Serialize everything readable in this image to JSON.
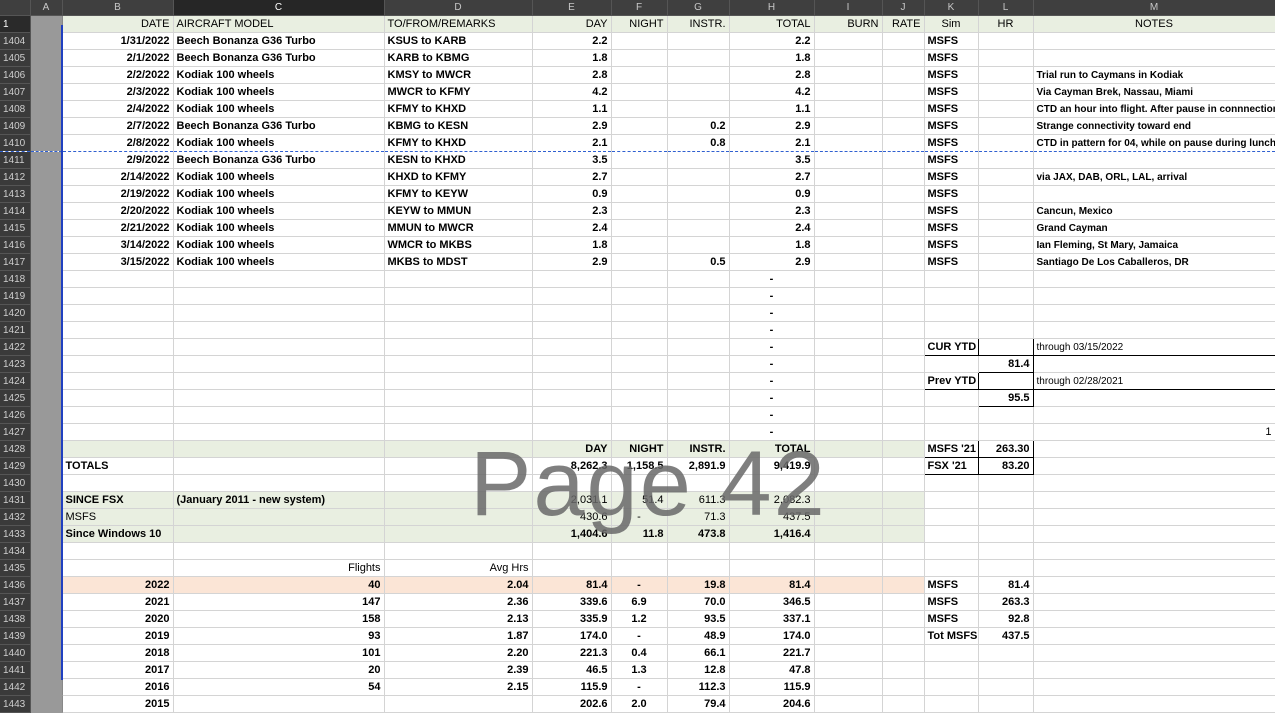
{
  "col_headers": [
    "",
    "A",
    "B",
    "C",
    "D",
    "E",
    "F",
    "G",
    "H",
    "I",
    "J",
    "K",
    "L",
    "M"
  ],
  "row_numbers": [
    "1",
    "1404",
    "1405",
    "1406",
    "1407",
    "1408",
    "1409",
    "1410",
    "1411",
    "1412",
    "1413",
    "1414",
    "1415",
    "1416",
    "1417",
    "1418",
    "1419",
    "1420",
    "1421",
    "1422",
    "1423",
    "1424",
    "1425",
    "1426",
    "1427",
    "1428",
    "1429",
    "1430",
    "1431",
    "1432",
    "1433",
    "1434",
    "1435",
    "1436",
    "1437",
    "1438",
    "1439",
    "1440",
    "1441",
    "1442",
    "1443"
  ],
  "headers": {
    "date": "DATE",
    "model": "AIRCRAFT MODEL",
    "route": "TO/FROM/REMARKS",
    "day": "DAY",
    "night": "NIGHT",
    "instr": "INSTR.",
    "total": "TOTAL",
    "burn": "BURN",
    "rate": "RATE",
    "sim": "Sim",
    "hr": "HR",
    "notes": "NOTES"
  },
  "flights": [
    {
      "date": "1/31/2022",
      "model": "Beech Bonanza G36 Turbo",
      "route": "KSUS to KARB",
      "day": "2.2",
      "instr": "",
      "total": "2.2",
      "sim": "MSFS",
      "note": "",
      "note_red": false
    },
    {
      "date": "2/1/2022",
      "model": "Beech Bonanza G36 Turbo",
      "route": "KARB to KBMG",
      "day": "1.8",
      "instr": "",
      "total": "1.8",
      "sim": "MSFS",
      "note": "",
      "note_red": false
    },
    {
      "date": "2/2/2022",
      "model": "Kodiak 100 wheels",
      "route": "KMSY to MWCR",
      "day": "2.8",
      "instr": "",
      "total": "2.8",
      "sim": "MSFS",
      "note": "Trial run to Caymans in Kodiak",
      "note_red": false
    },
    {
      "date": "2/3/2022",
      "model": "Kodiak 100 wheels",
      "route": "MWCR to KFMY",
      "day": "4.2",
      "instr": "",
      "total": "4.2",
      "sim": "MSFS",
      "note": "Via Cayman Brek, Nassau, Miami",
      "note_red": false
    },
    {
      "date": "2/4/2022",
      "model": "Kodiak 100 wheels",
      "route": "KFMY to KHXD",
      "day": "1.1",
      "instr": "",
      "total": "1.1",
      "sim": "MSFS",
      "note": "CTD an hour into flight. After pause in connnection",
      "note_red": true
    },
    {
      "date": "2/7/2022",
      "model": "Beech Bonanza G36 Turbo",
      "route": "KBMG to KESN",
      "day": "2.9",
      "instr": "0.2",
      "total": "2.9",
      "sim": "MSFS",
      "note": "Strange connectivity toward end",
      "note_red": false
    },
    {
      "date": "2/8/2022",
      "model": "Kodiak 100 wheels",
      "route": "KFMY to KHXD",
      "day": "2.1",
      "instr": "0.8",
      "total": "2.1",
      "sim": "MSFS",
      "note": "CTD in pattern for 04, while on pause during lunch",
      "note_red": true
    },
    {
      "date": "2/9/2022",
      "model": "Beech Bonanza G36 Turbo",
      "route": "KESN to KHXD",
      "day": "3.5",
      "instr": "",
      "total": "3.5",
      "sim": "MSFS",
      "note": "",
      "note_red": false
    },
    {
      "date": "2/14/2022",
      "model": "Kodiak 100 wheels",
      "route": "KHXD to KFMY",
      "day": "2.7",
      "instr": "",
      "total": "2.7",
      "sim": "MSFS",
      "note": "via JAX, DAB, ORL, LAL, arrival",
      "note_red": false
    },
    {
      "date": "2/19/2022",
      "model": "Kodiak 100 wheels",
      "route": "KFMY to KEYW",
      "day": "0.9",
      "instr": "",
      "total": "0.9",
      "sim": "MSFS",
      "note": "",
      "note_red": false
    },
    {
      "date": "2/20/2022",
      "model": "Kodiak 100 wheels",
      "route": "KEYW to MMUN",
      "day": "2.3",
      "instr": "",
      "total": "2.3",
      "sim": "MSFS",
      "note": "Cancun, Mexico",
      "note_red": false
    },
    {
      "date": "2/21/2022",
      "model": "Kodiak 100 wheels",
      "route": "MMUN to MWCR",
      "day": "2.4",
      "instr": "",
      "total": "2.4",
      "sim": "MSFS",
      "note": "Grand Cayman",
      "note_red": false
    },
    {
      "date": "3/14/2022",
      "model": "Kodiak 100 wheels",
      "route": "WMCR to MKBS",
      "day": "1.8",
      "instr": "",
      "total": "1.8",
      "sim": "MSFS",
      "note": "Ian Fleming, St Mary, Jamaica",
      "note_red": false
    },
    {
      "date": "3/15/2022",
      "model": "Kodiak 100 wheels",
      "route": "MKBS to MDST",
      "day": "2.9",
      "instr": "0.5",
      "total": "2.9",
      "sim": "MSFS",
      "note": "Santiago De Los Caballeros, DR",
      "note_red": false
    }
  ],
  "dash": "-",
  "ytd": {
    "cur_label": "CUR YTD",
    "cur_value": "81.4",
    "cur_note": "through 03/15/2022",
    "prev_label": "Prev YTD",
    "prev_value": "95.5",
    "prev_note": "through 02/28/2021"
  },
  "stray_1427": "1",
  "sim_totals": [
    {
      "label": "MSFS '21",
      "value": "263.30"
    },
    {
      "label": "FSX '21",
      "value": "83.20"
    }
  ],
  "totals": {
    "label": "TOTALS",
    "day": "8,262.3",
    "night": "1,158.5",
    "instr": "2,891.9",
    "total": "9,419.9"
  },
  "since_fsx": {
    "label": "SINCE FSX",
    "remark": "(January 2011 - new system)",
    "day": "2,031.1",
    "night": "51.4",
    "instr": "611.3",
    "total": "2,082.3"
  },
  "msfs_row": {
    "label": "MSFS",
    "day": "430.6",
    "night": "-",
    "instr": "71.3",
    "total": "437.5"
  },
  "win10": {
    "label": "Since Windows 10",
    "day": "1,404.6",
    "night": "11.8",
    "instr": "473.8",
    "total": "1,416.4"
  },
  "yearly_headers": {
    "flights": "Flights",
    "avg": "Avg Hrs"
  },
  "years": [
    {
      "year": "2022",
      "flights": "40",
      "avg": "2.04",
      "day": "81.4",
      "night": "-",
      "instr": "19.8",
      "total": "81.4",
      "sim": "MSFS",
      "hr": "81.4"
    },
    {
      "year": "2021",
      "flights": "147",
      "avg": "2.36",
      "day": "339.6",
      "night": "6.9",
      "instr": "70.0",
      "total": "346.5",
      "sim": "MSFS",
      "hr": "263.3"
    },
    {
      "year": "2020",
      "flights": "158",
      "avg": "2.13",
      "day": "335.9",
      "night": "1.2",
      "instr": "93.5",
      "total": "337.1",
      "sim": "MSFS",
      "hr": "92.8"
    },
    {
      "year": "2019",
      "flights": "93",
      "avg": "1.87",
      "day": "174.0",
      "night": "-",
      "instr": "48.9",
      "total": "174.0",
      "sim": "Tot MSFS",
      "hr": "437.5"
    },
    {
      "year": "2018",
      "flights": "101",
      "avg": "2.20",
      "day": "221.3",
      "night": "0.4",
      "instr": "66.1",
      "total": "221.7",
      "sim": "",
      "hr": ""
    },
    {
      "year": "2017",
      "flights": "20",
      "avg": "2.39",
      "day": "46.5",
      "night": "1.3",
      "instr": "12.8",
      "total": "47.8",
      "sim": "",
      "hr": ""
    },
    {
      "year": "2016",
      "flights": "54",
      "avg": "2.15",
      "day": "115.9",
      "night": "-",
      "instr": "112.3",
      "total": "115.9",
      "sim": "",
      "hr": ""
    },
    {
      "year": "2015",
      "flights": "",
      "avg": "",
      "day": "202.6",
      "night": "2.0",
      "instr": "79.4",
      "total": "204.6",
      "sim": "",
      "hr": ""
    }
  ],
  "watermark": "Page 42"
}
